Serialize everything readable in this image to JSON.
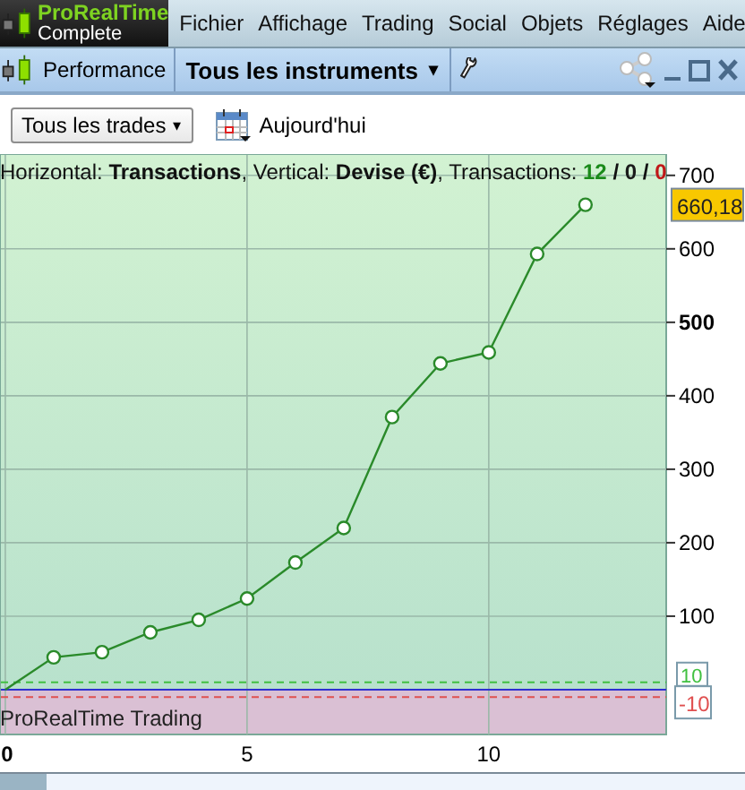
{
  "menubar": {
    "logo": {
      "title": "ProRealTime",
      "subtitle": "Complete"
    },
    "items": [
      "Fichier",
      "Affichage",
      "Trading",
      "Social",
      "Objets",
      "Réglages",
      "Aide"
    ]
  },
  "toolbar": {
    "title": "Performance",
    "instrument_menu": "Tous les instruments",
    "caret": "▾"
  },
  "filters": {
    "trade_filter": "Tous les trades",
    "caret": "▾",
    "date_button": "Aujourd'hui"
  },
  "chart": {
    "caption": "Horizontal: **Transactions**, Vertical: **Devise (€)**, Transactions: ",
    "counts": [
      {
        "text": "12",
        "color": "#1a8a1a"
      },
      {
        "text": "0",
        "color": "#1a1a1a"
      },
      {
        "text": "0",
        "color": "#c01818"
      }
    ],
    "count_separator": " / ",
    "last_value_label": "660,18",
    "footer_label": "ProRealTime Trading",
    "chart_data": {
      "type": "line",
      "x": [
        0,
        1,
        2,
        3,
        4,
        5,
        6,
        7,
        8,
        9,
        10,
        11,
        12
      ],
      "series": [
        {
          "color": "#2a8a2a",
          "marker": "circle",
          "values": [
            0,
            44,
            51,
            78,
            95,
            124,
            173,
            220,
            371,
            444,
            459,
            593,
            660
          ]
        }
      ],
      "xticks": [
        0,
        5,
        10
      ],
      "yticks": [
        100,
        200,
        300,
        400,
        500,
        600,
        700
      ],
      "xlim": [
        -0.11,
        13.67
      ],
      "ylim": [
        -61,
        729
      ],
      "grid": true,
      "ref_lines": [
        {
          "axis": "y",
          "value": 10,
          "label": "10",
          "color": "#40c040"
        },
        {
          "axis": "y",
          "value": -10,
          "label": "-10",
          "color": "#e05050"
        },
        {
          "axis": "y",
          "value": 0,
          "color": "#3030d0"
        }
      ],
      "bands": [
        {
          "axis": "y",
          "from": -61,
          "to": 0,
          "color": "#dac0d4"
        }
      ]
    }
  }
}
